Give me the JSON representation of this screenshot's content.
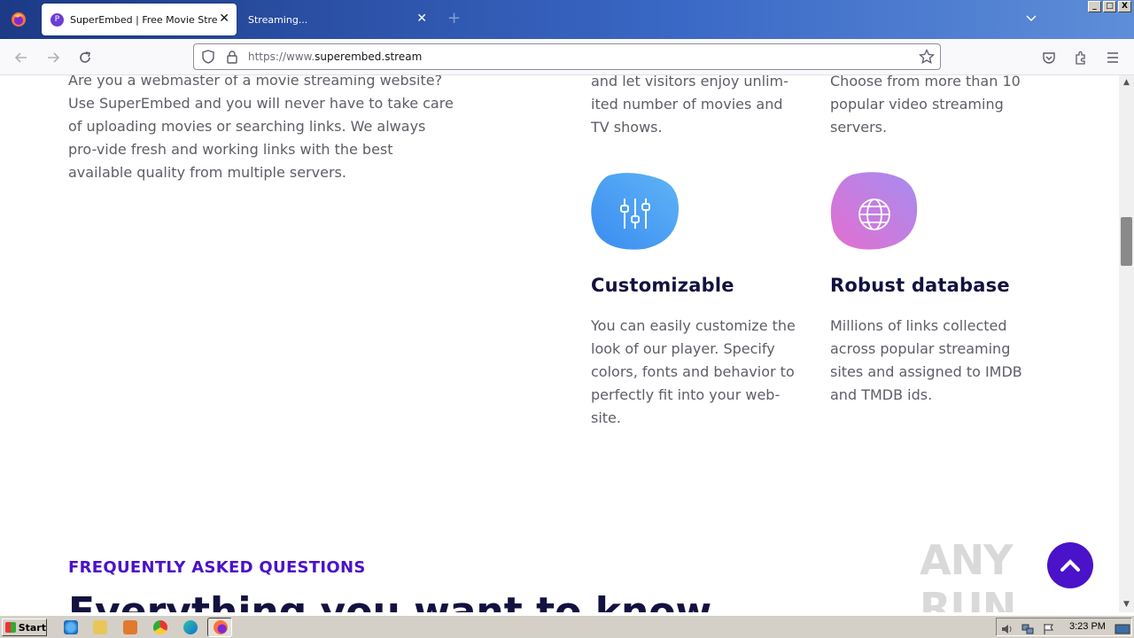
{
  "browser": {
    "tabs": [
      {
        "title": "SuperEmbed | Free Movie Streaming",
        "active": true
      },
      {
        "title": "Streaming...",
        "active": false
      }
    ],
    "url_prefix": "https://www.",
    "url_domain": "superembed.stream",
    "favicon_letter": "P",
    "new_tab_label": "+",
    "close_label": "✕",
    "list_tabs_label": "⌵"
  },
  "page": {
    "intro_text": "Are you a webmaster of a movie streaming website? Use SuperEmbed and you will never have to take care of uploading movies or searching links. We always pro-vide fresh and working links with the best available quality from multiple servers.",
    "feature_top_left_text": "and let visitors enjoy unlim-ited number of movies and TV shows.",
    "feature_top_right_text": "Choose from more than 10 popular video streaming servers.",
    "features": [
      {
        "title": "Customizable",
        "text": "You can easily customize the look of our player. Specify colors, fonts and behavior to perfectly fit into your web-site.",
        "icon": "sliders-icon",
        "gradient": [
          "#3a8cf0",
          "#5fb4f6"
        ]
      },
      {
        "title": "Robust database",
        "text": "Millions of links collected across popular streaming sites and assigned to IMDB and TMDB ids.",
        "icon": "globe-icon",
        "gradient": [
          "#e36fd0",
          "#a68cf0"
        ]
      }
    ],
    "faq_label": "FREQUENTLY ASKED QUESTIONS",
    "faq_heading": "Everything you want to know",
    "accent_color": "#4a12c9",
    "watermark": "ANY RUN"
  },
  "taskbar": {
    "start_label": "Start",
    "clock": "3:23 PM"
  }
}
